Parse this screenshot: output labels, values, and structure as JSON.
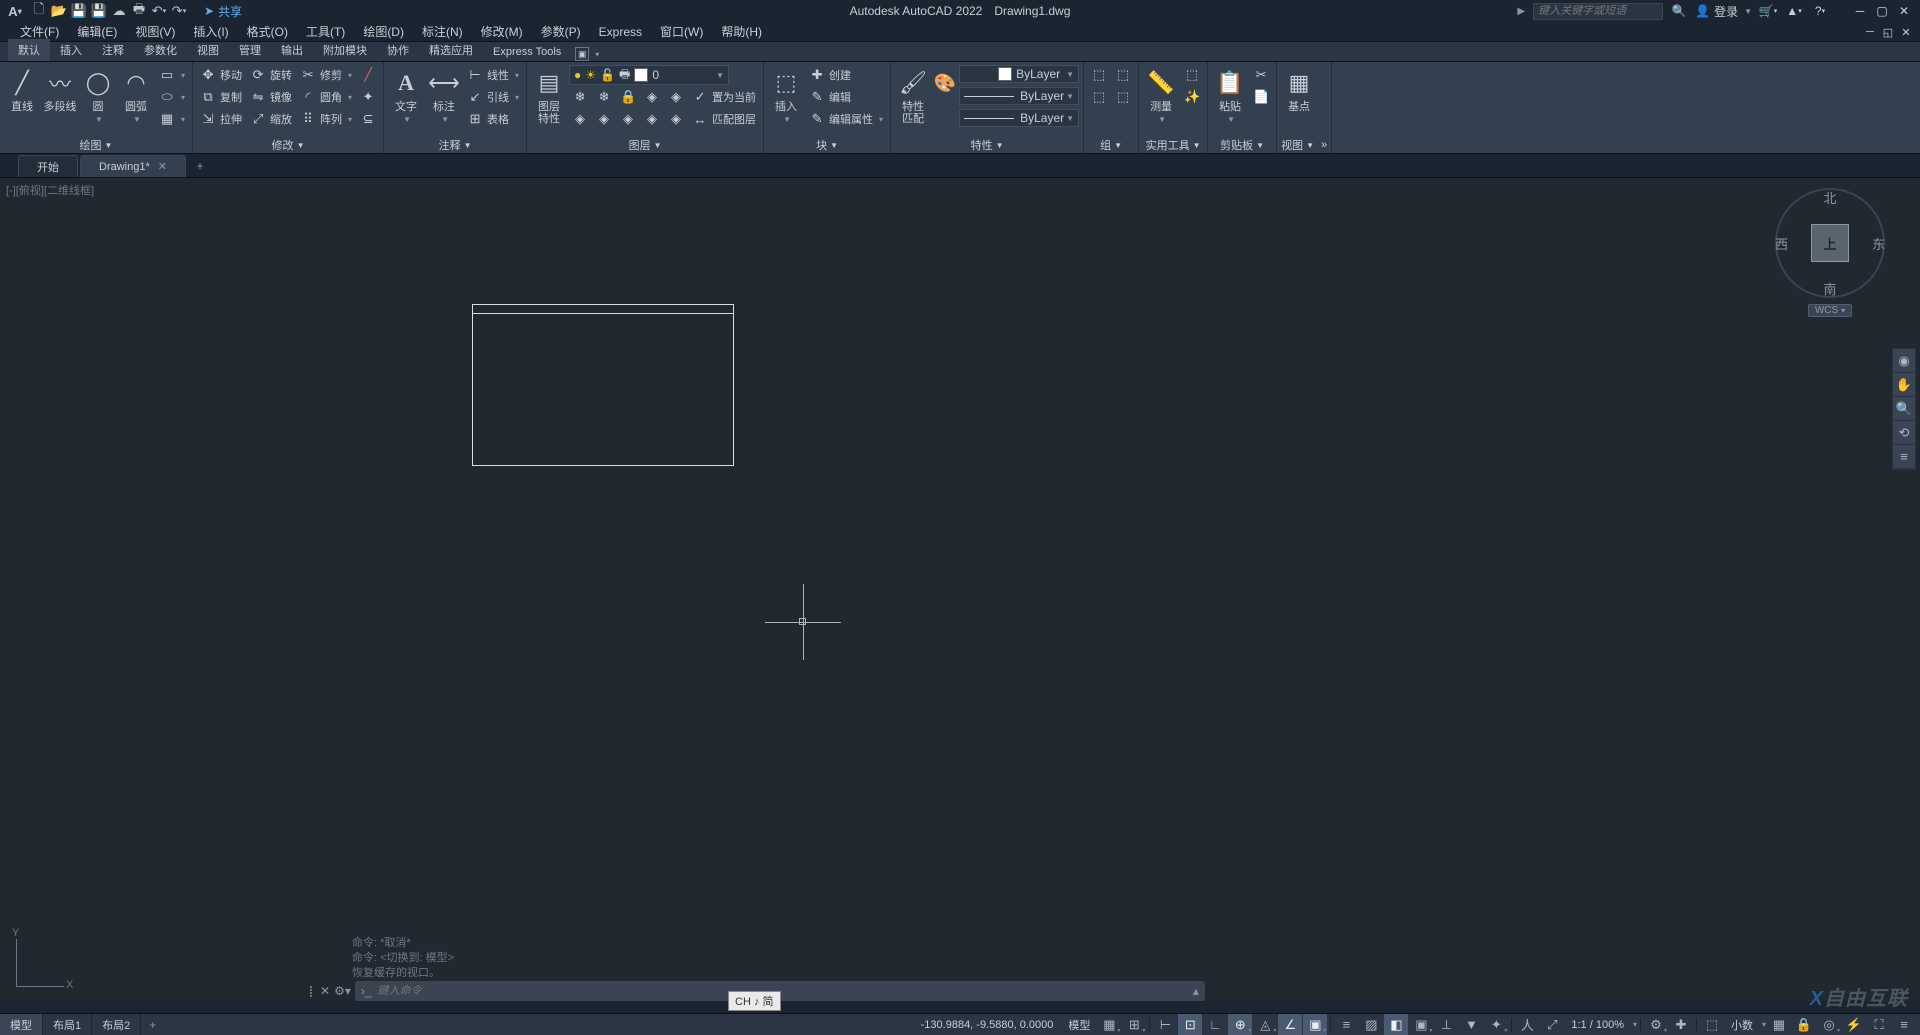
{
  "title": {
    "app": "Autodesk AutoCAD 2022",
    "doc": "Drawing1.dwg"
  },
  "share_label": "共享",
  "search_placeholder": "键入关键字或短语",
  "login_label": "登录",
  "menu": [
    "文件(F)",
    "编辑(E)",
    "视图(V)",
    "插入(I)",
    "格式(O)",
    "工具(T)",
    "绘图(D)",
    "标注(N)",
    "修改(M)",
    "参数(P)",
    "Express",
    "窗口(W)",
    "帮助(H)"
  ],
  "ribbon_tabs": [
    "默认",
    "插入",
    "注释",
    "参数化",
    "视图",
    "管理",
    "输出",
    "附加模块",
    "协作",
    "精选应用",
    "Express Tools"
  ],
  "panels": {
    "draw": {
      "title": "绘图",
      "line": "直线",
      "polyline": "多段线",
      "circle": "圆",
      "arc": "圆弧"
    },
    "modify": {
      "title": "修改",
      "move": "移动",
      "rotate": "旋转",
      "trim": "修剪",
      "copy": "复制",
      "mirror": "镜像",
      "fillet": "圆角",
      "stretch": "拉伸",
      "scale": "缩放",
      "array": "阵列"
    },
    "annot": {
      "title": "注释",
      "text": "文字",
      "dim": "标注",
      "linear": "线性",
      "leader": "引线",
      "table": "表格"
    },
    "layer": {
      "title": "图层",
      "props": "图层\n特性",
      "current": "0",
      "setcurrent": "置为当前",
      "match": "匹配图层"
    },
    "block": {
      "title": "块",
      "insert": "插入",
      "create": "创建",
      "edit": "编辑",
      "editattr": "编辑属性"
    },
    "props": {
      "title": "特性",
      "match": "特性\n匹配",
      "bylayer": "ByLayer"
    },
    "group": {
      "title": "组"
    },
    "util": {
      "title": "实用工具",
      "measure": "测量"
    },
    "clip": {
      "title": "剪贴板",
      "paste": "粘贴"
    },
    "base": {
      "title": "基点"
    },
    "view": {
      "title": "视图"
    }
  },
  "dwg_tabs": {
    "start": "开始",
    "current": "Drawing1*"
  },
  "viewport_label": "[-][俯视][二维线框]",
  "viewcube": {
    "top": "上",
    "n": "北",
    "s": "南",
    "w": "西",
    "e": "东",
    "wcs": "WCS"
  },
  "ucs": {
    "x": "X",
    "y": "Y"
  },
  "cmd": {
    "hist1": "命令: *取消*",
    "hist2": "命令:   <切换到: 模型>",
    "hist3": "恢复缓存的视口。",
    "placeholder": "键入命令"
  },
  "ime": "CH ♪ 简",
  "layout_tabs": [
    "模型",
    "布局1",
    "布局2"
  ],
  "status": {
    "coords": "-130.9884, -9.5880, 0.0000",
    "model": "模型",
    "scale": "1:1 / 100%",
    "decimal": "小数"
  },
  "watermark": "自由互联"
}
